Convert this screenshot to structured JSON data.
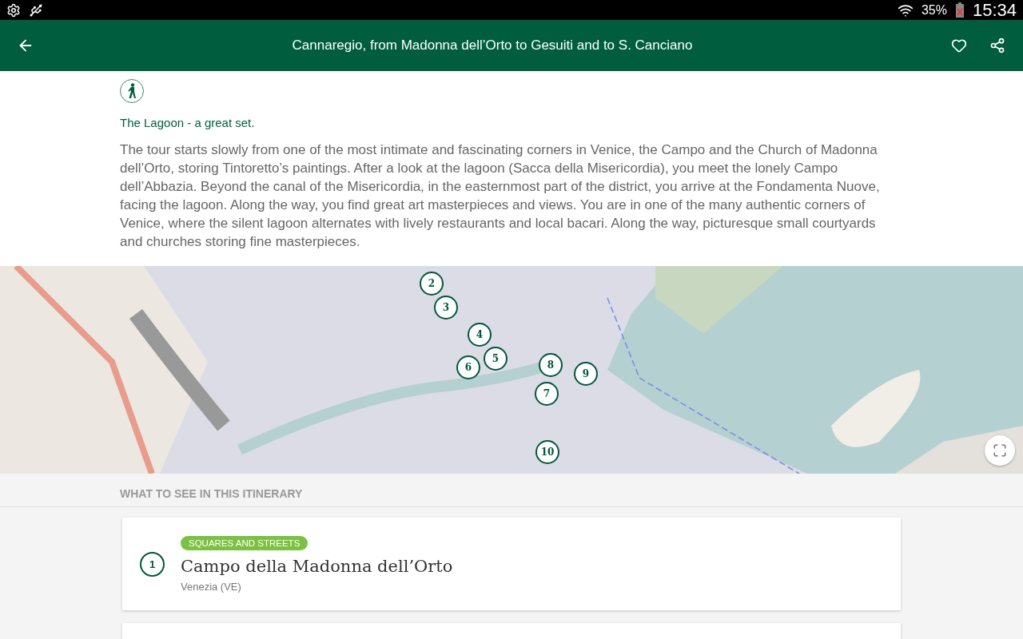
{
  "status_bar": {
    "battery": "35%",
    "time": "15:34"
  },
  "app_bar": {
    "title": "Cannaregio, from Madonna dell’Orto to Gesuiti and to S. Canciano",
    "favorite": false
  },
  "intro": {
    "subtitle": "The Lagoon - a great set.",
    "description": "The tour starts slowly from one of the most intimate and fascinating corners in Venice, the Campo and the Church of Madonna dell’Orto, storing Tintoretto’s paintings. After a look at the lagoon (Sacca della Misericordia), you meet the lonely Campo dell’Abbazia. Beyond the canal of the Misericordia, in the easternmost part of the district, you arrive at the Fondamenta Nuove, facing the lagoon. Along the way, you find great art masterpieces and views. You are in one of the many authentic corners of Venice, where the silent lagoon alternates with lively restaurants and local bacari. Along the way, picturesque small courtyards and churches storing fine masterpieces."
  },
  "map": {
    "markers": [
      {
        "label": "2"
      },
      {
        "label": "3"
      },
      {
        "label": "4"
      },
      {
        "label": "5"
      },
      {
        "label": "6"
      },
      {
        "label": "7"
      },
      {
        "label": "8"
      },
      {
        "label": "9"
      },
      {
        "label": "10"
      }
    ]
  },
  "section_title": "WHAT TO SEE IN THIS ITINERARY",
  "places": [
    {
      "number": "1",
      "tag": "SQUARES AND STREETS",
      "name": "Campo della Madonna dell’Orto",
      "location": "Venezia (VE)"
    }
  ]
}
